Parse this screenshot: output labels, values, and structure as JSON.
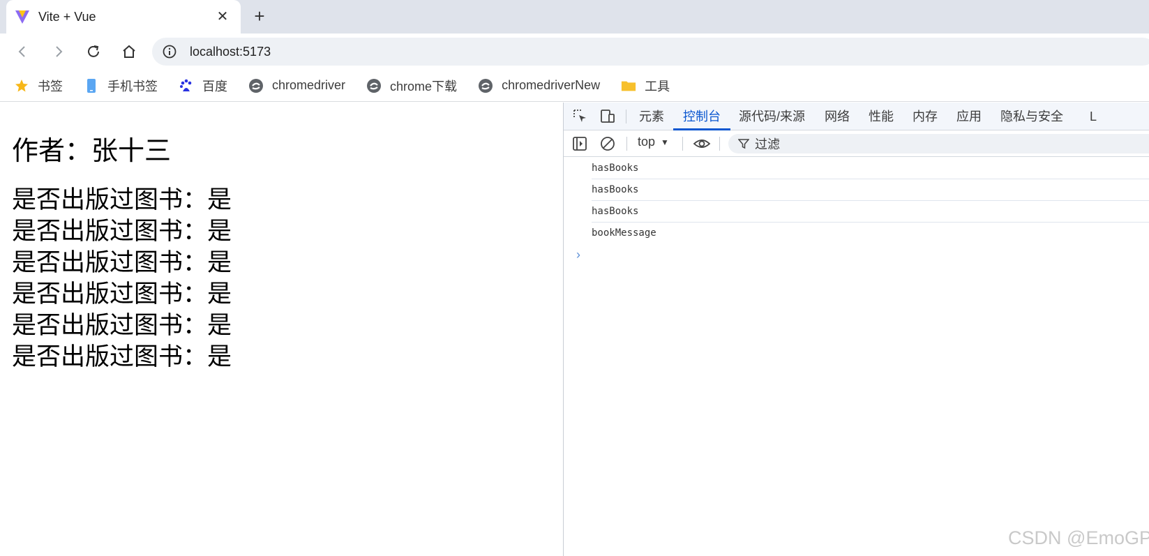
{
  "tab": {
    "title": "Vite + Vue",
    "close_glyph": "✕",
    "new_tab_glyph": "+"
  },
  "address": {
    "url": "localhost:5173"
  },
  "bookmarks": [
    {
      "label": "书签",
      "icon": "star-icon"
    },
    {
      "label": "手机书签",
      "icon": "phone-icon"
    },
    {
      "label": "百度",
      "icon": "baidu-icon"
    },
    {
      "label": "chromedriver",
      "icon": "edge-icon"
    },
    {
      "label": "chrome下载",
      "icon": "edge-icon"
    },
    {
      "label": "chromedriverNew",
      "icon": "edge-icon"
    },
    {
      "label": "工具",
      "icon": "folder-icon"
    }
  ],
  "page": {
    "author": "作者：张十三",
    "lines": [
      "是否出版过图书：是",
      "是否出版过图书：是",
      "是否出版过图书：是",
      "是否出版过图书：是",
      "是否出版过图书：是",
      "是否出版过图书：是"
    ]
  },
  "devtools": {
    "tabs": [
      "元素",
      "控制台",
      "源代码/来源",
      "网络",
      "性能",
      "内存",
      "应用",
      "隐私与安全",
      "L"
    ],
    "active_tab": "控制台",
    "context": "top",
    "filter_label": "过滤",
    "messages": [
      "hasBooks",
      "hasBooks",
      "hasBooks",
      "bookMessage"
    ],
    "prompt_glyph": "›"
  },
  "watermark": "CSDN @EmoGP",
  "colors": {
    "accent": "#0b57d0",
    "tabstrip": "#dfe3eb"
  }
}
